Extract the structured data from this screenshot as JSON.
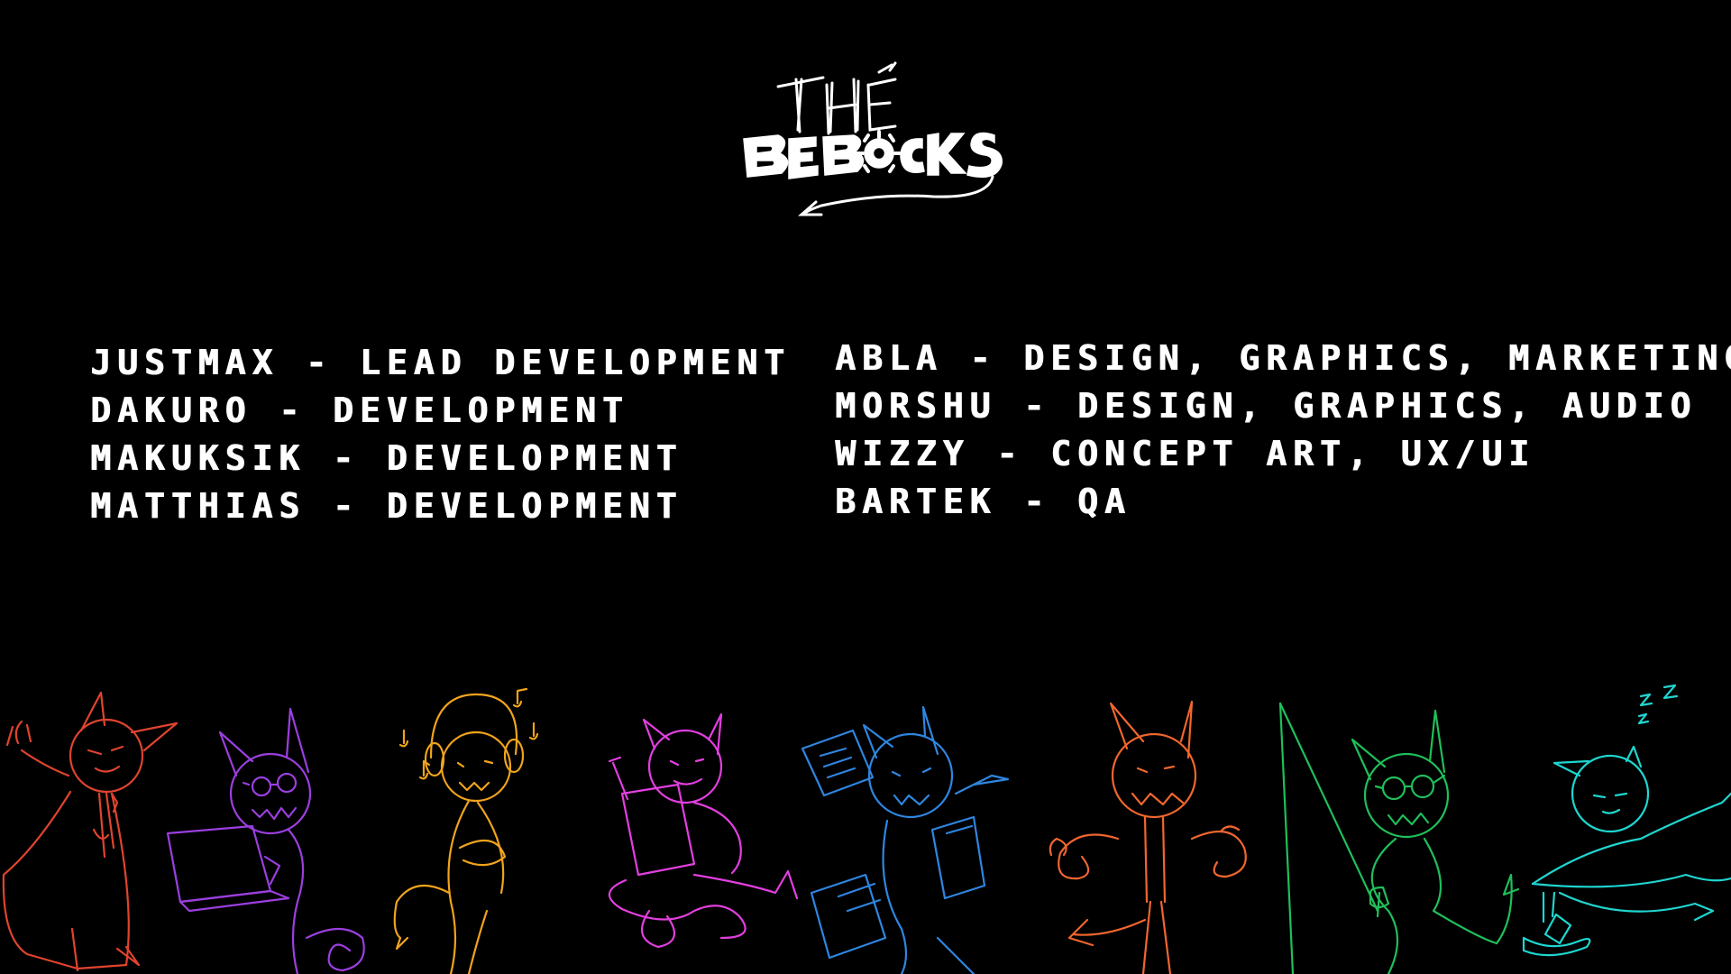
{
  "logo": {
    "line1": "THE",
    "line2": "BEBOCKS"
  },
  "credits": {
    "left": [
      {
        "name": "JUSTMAX",
        "separator": " - ",
        "role": "LEAD DEVELOPMENT"
      },
      {
        "name": "DAKURO",
        "separator": " - ",
        "role": "DEVELOPMENT"
      },
      {
        "name": "MAKUKSIK",
        "separator": " - ",
        "role": "DEVELOPMENT"
      },
      {
        "name": "MATTHIAS",
        "separator": " - ",
        "role": "DEVELOPMENT"
      }
    ],
    "right": [
      {
        "name": "ABLA",
        "separator": " - ",
        "role": "DESIGN, GRAPHICS, MARKETING"
      },
      {
        "name": "MORSHU",
        "separator": " - ",
        "role": "DESIGN, GRAPHICS, AUDIO"
      },
      {
        "name": "WIZZY",
        "separator": " - ",
        "role": "CONCEPT ART, UX/UI"
      },
      {
        "name": "BARTEK",
        "separator": " - ",
        "role": "QA"
      }
    ]
  },
  "doodles": {
    "characters": [
      {
        "name": "caped-devil",
        "color": "#e0442f"
      },
      {
        "name": "laptop-devil",
        "color": "#9b3fe0"
      },
      {
        "name": "headphones-devil",
        "color": "#f0a41c"
      },
      {
        "name": "drawing-devil",
        "color": "#e33fe0"
      },
      {
        "name": "papers-devil",
        "color": "#2f86e0"
      },
      {
        "name": "flexing-devil",
        "color": "#f0662f"
      },
      {
        "name": "fishing-devil",
        "color": "#1fbf5a"
      },
      {
        "name": "sleeping-devil",
        "color": "#1fd6d0"
      }
    ],
    "sleep_text": "z z z"
  },
  "colors": {
    "background": "#000000",
    "text": "#ffffff"
  }
}
